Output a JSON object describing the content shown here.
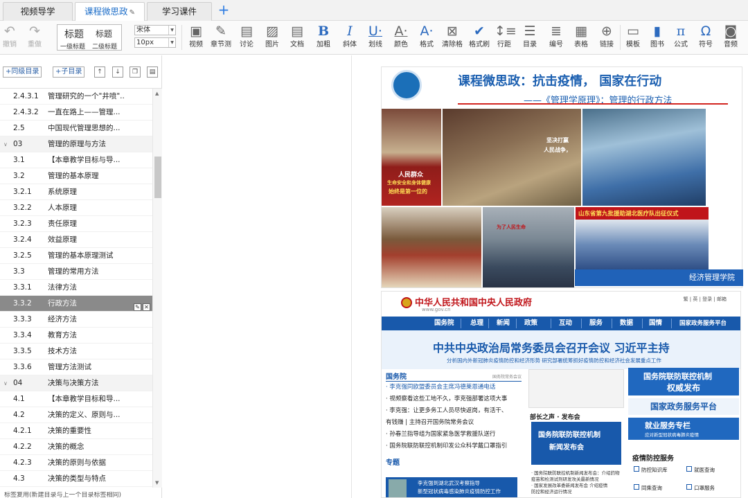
{
  "tabs": [
    {
      "label": "视频导学",
      "active": false
    },
    {
      "label": "课程微思政",
      "active": true
    },
    {
      "label": "学习课件",
      "active": false
    }
  ],
  "toolbar": {
    "undo": "撤销",
    "redo": "重做",
    "heading1": "标题",
    "heading2": "标题",
    "heading1_label": "一级标题",
    "heading2_label": "二级标题",
    "font_family": "宋体",
    "font_size": "10px",
    "buttons": [
      "视频",
      "章节测",
      "讨论",
      "图片",
      "文档",
      "加粗",
      "斜体",
      "划线",
      "颜色",
      "格式",
      "清除格",
      "格式刷",
      "行距",
      "目录",
      "编号",
      "表格",
      "链接",
      "模板",
      "图书",
      "公式",
      "符号",
      "音频"
    ]
  },
  "sidebar": {
    "add_same_level": "+同级目录",
    "add_child": "+子目录",
    "footer": "标签复用(新建目录与上一个目录标签相同)",
    "items": [
      {
        "num": "2.4.3.1",
        "title": "管理研究的一个\"井喷\"..."
      },
      {
        "num": "2.4.3.2",
        "title": "一直在路上——管理..."
      },
      {
        "num": "2.5",
        "title": "中国现代管理思想的..."
      },
      {
        "num": "03",
        "title": "管理的原理与方法",
        "chapter": true
      },
      {
        "num": "3.1",
        "title": "【本章教学目标与导..."
      },
      {
        "num": "3.2",
        "title": "管理的基本原理"
      },
      {
        "num": "3.2.1",
        "title": "系统原理"
      },
      {
        "num": "3.2.2",
        "title": "人本原理"
      },
      {
        "num": "3.2.3",
        "title": "责任原理"
      },
      {
        "num": "3.2.4",
        "title": "效益原理"
      },
      {
        "num": "3.2.5",
        "title": "管理的基本原理测试"
      },
      {
        "num": "3.3",
        "title": "管理的常用方法"
      },
      {
        "num": "3.3.1",
        "title": "法律方法"
      },
      {
        "num": "3.3.2",
        "title": "行政方法",
        "selected": true
      },
      {
        "num": "3.3.3",
        "title": "经济方法"
      },
      {
        "num": "3.3.4",
        "title": "教育方法"
      },
      {
        "num": "3.3.5",
        "title": "技术方法"
      },
      {
        "num": "3.3.6",
        "title": "管理方法测试"
      },
      {
        "num": "04",
        "title": "决策与决策方法",
        "chapter": true
      },
      {
        "num": "4.1",
        "title": "【本章教学目标和导..."
      },
      {
        "num": "4.2",
        "title": "决策的定义、原则与..."
      },
      {
        "num": "4.2.1",
        "title": "决策的重要性"
      },
      {
        "num": "4.2.2",
        "title": "决策的概念"
      },
      {
        "num": "4.2.3",
        "title": "决策的原则与依据"
      },
      {
        "num": "4.3",
        "title": "决策的类型与特点"
      }
    ]
  },
  "doc_image": {
    "title": "课程微思政：抗击疫情， 国家在行动",
    "subtitle": "——《管理学原理》：管理的行政方法",
    "photo1_caption": "人民群众",
    "photo1_caption2": "生命安全和身体健康",
    "photo1_caption3": "始终是第一位的",
    "photo2_caption": "坚决打赢",
    "photo2_caption2": "人民战争，",
    "photo4_caption": "为了人民生命",
    "photo6_caption": "山东省第九批援助湖北医疗队出征仪式",
    "college": "经济管理学院"
  },
  "gov_site": {
    "title": "中华人民共和国中央人民政府",
    "url": "www.gov.cn",
    "top_right": "繁 | 英 | 登录 | 邮箱",
    "nav": [
      "国务院",
      "总理",
      "新闻",
      "政策",
      "互动",
      "服务",
      "数据",
      "国情",
      "国家政务服务平台"
    ],
    "headline": "中共中央政治局常务委员会召开会议 习近平主持",
    "subheadline": "分析国内外新冠肺炎疫情防控和经济形势 研究部署统筹抓好疫情防控和经济社会发展重点工作",
    "section_title": "国务院",
    "section_more": "国务院常务会议",
    "news": [
      "· 李克强同欧盟委员会主席冯德莱恩通电话",
      "· 视频察看这些工地不久，李克强部署这项大事",
      "· 李克强：让更多务工人员尽快返岗，有活干、",
      "  有钱赚 | 主持召开国务院常务会议",
      "· 孙春兰指导组为国家紧急医学救援队送行",
      "· 国务院联防联控机制印发公众科学戴口罩指引"
    ],
    "topic": "专题",
    "topic_text1": "李克强到湖北武汉考察指导",
    "topic_text2": "新型冠状病毒感染肺炎疫情防控工作",
    "mid_label": "部长之声 · 发布会",
    "mid_block1": "国务院联防联控机制",
    "mid_block2": "新闻发布会",
    "mid_bullets": [
      "· 国务院联防联控机制新闻发布会：介绍药物",
      "  疫苗和检测试剂研发攻关最新情况",
      "· 国家发展改革委新闻发布会 介绍疫情",
      "  防控和经济运行情况"
    ],
    "right_block1": "国务院联防联控机制",
    "right_block2": "权威发布",
    "right_platform": "国家政务服务平台",
    "right_special": "就业服务专栏",
    "right_special_sub": "应对新型冠状病毒肺炎疫情",
    "epidemic_service": "疫情防控服务",
    "services": [
      "防控知识库",
      "就医查询",
      "同乘查询",
      "口罩服务"
    ]
  }
}
